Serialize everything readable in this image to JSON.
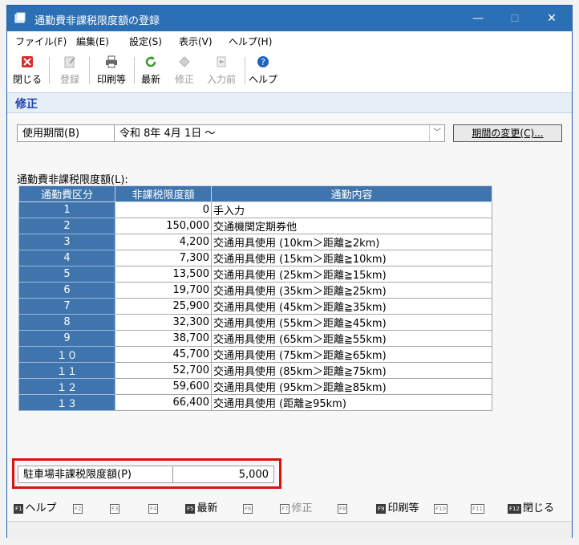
{
  "window": {
    "title": "通勤費非課税限度額の登録",
    "minimize": "—",
    "maximize": "☐",
    "close": "✕"
  },
  "menu": [
    "ファイル(F)",
    "編集(E)",
    "設定(S)",
    "表示(V)",
    "ヘルプ(H)"
  ],
  "toolbar": {
    "close": "閉じる",
    "register": "登録",
    "print": "印刷等",
    "refresh": "最新",
    "edit": "修正",
    "prev": "入力前",
    "help": "ヘルプ"
  },
  "mode": "修正",
  "period": {
    "label": "使用期間(B)",
    "value": "令和 8年 4月 1日 ～",
    "change_button": "期間の変更(C)..."
  },
  "table": {
    "label": "通勤費非課税限度額(L):",
    "headers": [
      "通勤費区分",
      "非課税限度額",
      "通勤内容"
    ],
    "rows": [
      {
        "cat": "1",
        "amount": "0",
        "desc": "手入力"
      },
      {
        "cat": "2",
        "amount": "150,000",
        "desc": "交通機関定期券他"
      },
      {
        "cat": "3",
        "amount": "4,200",
        "desc": "交通用具使用 (10km＞距離≧2km)"
      },
      {
        "cat": "4",
        "amount": "7,300",
        "desc": "交通用具使用 (15km＞距離≧10km)"
      },
      {
        "cat": "5",
        "amount": "13,500",
        "desc": "交通用具使用 (25km＞距離≧15km)"
      },
      {
        "cat": "6",
        "amount": "19,700",
        "desc": "交通用具使用 (35km＞距離≧25km)"
      },
      {
        "cat": "7",
        "amount": "25,900",
        "desc": "交通用具使用 (45km＞距離≧35km)"
      },
      {
        "cat": "8",
        "amount": "32,300",
        "desc": "交通用具使用 (55km＞距離≧45km)"
      },
      {
        "cat": "9",
        "amount": "38,700",
        "desc": "交通用具使用 (65km＞距離≧55km)"
      },
      {
        "cat": "１０",
        "amount": "45,700",
        "desc": "交通用具使用 (75km＞距離≧65km)"
      },
      {
        "cat": "１１",
        "amount": "52,700",
        "desc": "交通用具使用 (85km＞距離≧75km)"
      },
      {
        "cat": "１２",
        "amount": "59,600",
        "desc": "交通用具使用 (95km＞距離≧85km)"
      },
      {
        "cat": "１３",
        "amount": "66,400",
        "desc": "交通用具使用 (距離≧95km)"
      }
    ]
  },
  "parking": {
    "label": "駐車場非課税限度額(P)",
    "value": "5,000"
  },
  "fkeys": [
    {
      "key": "F1",
      "label": "ヘルプ",
      "active": true
    },
    {
      "key": "F2",
      "label": "",
      "active": false
    },
    {
      "key": "F3",
      "label": "",
      "active": false
    },
    {
      "key": "F4",
      "label": "",
      "active": false
    },
    {
      "key": "F5",
      "label": "最新",
      "active": true
    },
    {
      "key": "F6",
      "label": "",
      "active": false
    },
    {
      "key": "F7",
      "label": "修正",
      "active": false
    },
    {
      "key": "F8",
      "label": "",
      "active": false
    },
    {
      "key": "F9",
      "label": "印刷等",
      "active": true
    },
    {
      "key": "F10",
      "label": "",
      "active": false
    },
    {
      "key": "F11",
      "label": "",
      "active": false
    },
    {
      "key": "F12",
      "label": "閉じる",
      "active": true
    }
  ],
  "colors": {
    "titlebar": "#2b6fb5",
    "header": "#3f74ad",
    "highlight_border": "#e01010"
  }
}
